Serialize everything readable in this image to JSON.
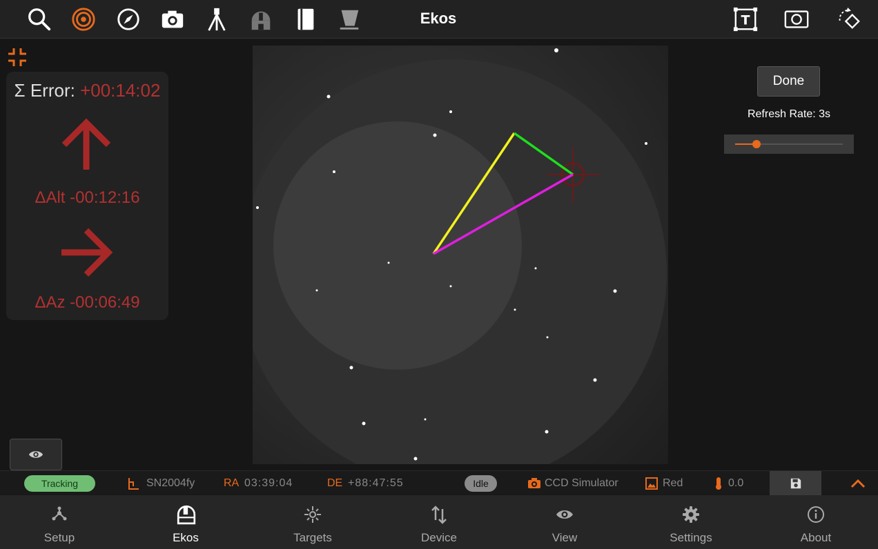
{
  "app": {
    "title": "Ekos"
  },
  "toolbar": {
    "left_icons": [
      "search-icon",
      "target-icon",
      "compass-icon",
      "camera-icon",
      "mount-icon",
      "observatory-icon",
      "notebook-icon",
      "telescope-icon"
    ],
    "right_icons": [
      "text-overlay-icon",
      "image-frame-icon",
      "rotate-icon"
    ],
    "accent": "#e86a1c"
  },
  "alignment": {
    "error_label": "Σ Error:",
    "error_value": "+00:14:02",
    "alt_delta": "ΔAlt -00:12:16",
    "az_delta": "ΔAz -00:06:49",
    "error_color": "#b53131"
  },
  "controls": {
    "done_label": "Done",
    "refresh_label": "Refresh Rate: 3s",
    "refresh_fraction": 0.2
  },
  "statusbar": {
    "mount_status": "Tracking",
    "target_name": "SN2004fy",
    "ra_label": "RA",
    "ra_value": "03:39:04",
    "de_label": "DE",
    "de_value": "+88:47:55",
    "capture_status": "Idle",
    "camera": "CCD Simulator",
    "filter": "Red",
    "temperature": "0.0"
  },
  "nav": {
    "items": [
      {
        "label": "Setup",
        "icon": "setup-icon"
      },
      {
        "label": "Ekos",
        "icon": "dome-icon"
      },
      {
        "label": "Targets",
        "icon": "targets-icon"
      },
      {
        "label": "Device",
        "icon": "device-icon"
      },
      {
        "label": "View",
        "icon": "view-icon"
      },
      {
        "label": "Settings",
        "icon": "gear-icon"
      },
      {
        "label": "About",
        "icon": "info-icon"
      }
    ],
    "active": "Ekos"
  }
}
